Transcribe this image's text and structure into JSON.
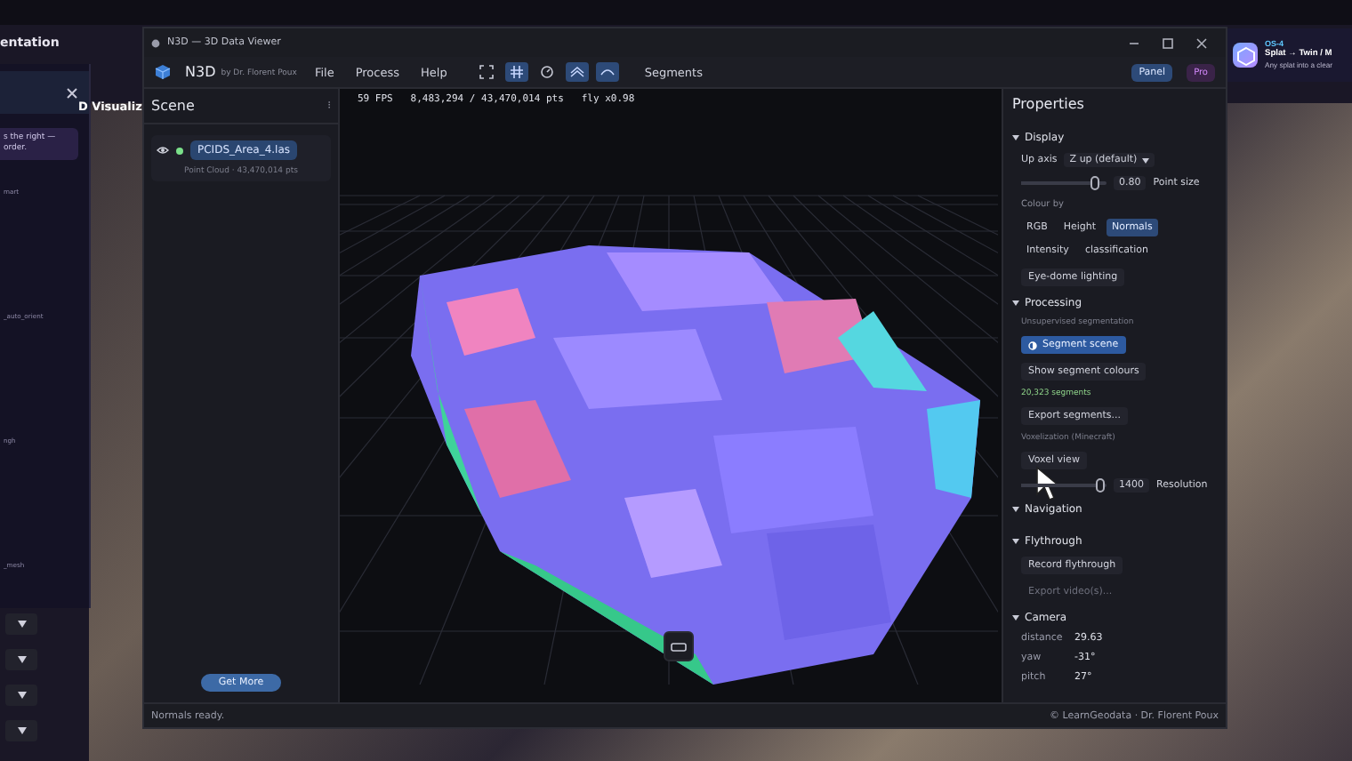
{
  "background": {
    "side_window": {
      "title": "entation",
      "note_lines": [
        "s the right —",
        "order."
      ],
      "heading": "D Visualiz",
      "labels": [
        "mart",
        "_auto_orient",
        "ngh",
        "_mesh"
      ]
    },
    "notification": {
      "badge": "OS-4",
      "title": "Splat → Twin / M",
      "text": "Any splat into a clear"
    }
  },
  "window": {
    "title": "N3D — 3D Data Viewer"
  },
  "menubar": {
    "app_name": "N3D",
    "byline": "by Dr. Florent Poux",
    "menus": [
      "File",
      "Process",
      "Help"
    ],
    "tools": [
      {
        "kind": "frame",
        "selected": false
      },
      {
        "kind": "grid",
        "selected": true
      },
      {
        "kind": "orbit",
        "selected": false
      },
      {
        "kind": "fly",
        "selected": true
      },
      {
        "kind": "walk",
        "selected": true
      }
    ],
    "segments_label": "Segments",
    "panel_button": "Panel",
    "pro_badge": "Pro"
  },
  "scene": {
    "title": "Scene",
    "menu_glyph": "⁝",
    "layers": [
      {
        "name": "PCIDS_Area_4.las",
        "info": "Point Cloud · 43,470,014 pts",
        "visible": true,
        "loaded": true
      }
    ],
    "get_more": "Get More"
  },
  "viewport": {
    "stats": "59 FPS   8,483,294 / 43,470,014 pts   fly x0.98"
  },
  "properties": {
    "title": "Properties",
    "sections": [
      {
        "title": "Display",
        "rows": [
          {
            "kind": "select",
            "label": "Up axis",
            "value": "Z up (default)"
          },
          {
            "kind": "slider",
            "level": 0.86,
            "value": "0.80",
            "label": "Point size"
          },
          {
            "kind": "caption",
            "text": "Colour by"
          },
          {
            "kind": "options",
            "options": [
              {
                "label": "RGB",
                "selected": false
              },
              {
                "label": "Height",
                "selected": false
              },
              {
                "label": "Normals",
                "selected": true
              },
              {
                "label": "Intensity",
                "selected": false
              },
              {
                "label": "classification",
                "selected": false
              }
            ]
          },
          {
            "kind": "button",
            "label": "Eye-dome lighting",
            "disabled": false,
            "hovered": false
          }
        ]
      },
      {
        "title": "Processing",
        "rows": [
          {
            "kind": "caption",
            "text": "Unsupervised segmentation"
          },
          {
            "kind": "primary",
            "label": "Segment scene"
          },
          {
            "kind": "button",
            "label": "Show segment colours",
            "disabled": false,
            "hovered": false
          },
          {
            "kind": "count",
            "text": "20,323 segments"
          },
          {
            "kind": "button",
            "label": "Export segments...",
            "disabled": false,
            "hovered": false
          },
          {
            "kind": "caption",
            "text": "Voxelization (Minecraft)"
          },
          {
            "kind": "button",
            "label": "Voxel view",
            "disabled": false,
            "hovered": true
          },
          {
            "kind": "slider",
            "level": 0.93,
            "value": "1400",
            "label": "Resolution"
          }
        ]
      },
      {
        "title": "Navigation"
      },
      {
        "title": "Flythrough",
        "rows": [
          {
            "kind": "button",
            "label": "Record flythrough",
            "disabled": false,
            "hovered": false
          },
          {
            "kind": "button",
            "label": "Export video(s)...",
            "disabled": true,
            "hovered": false
          }
        ]
      },
      {
        "title": "Camera",
        "rows": [
          {
            "kind": "stat",
            "label": "distance",
            "value": "29.63"
          },
          {
            "kind": "stat",
            "label": "yaw",
            "value": "-31°"
          },
          {
            "kind": "stat",
            "label": "pitch",
            "value": "27°"
          }
        ]
      }
    ]
  },
  "status_bar": {
    "message": "Normals ready.",
    "credit": "© LearnGeodata · Dr. Florent Poux"
  }
}
